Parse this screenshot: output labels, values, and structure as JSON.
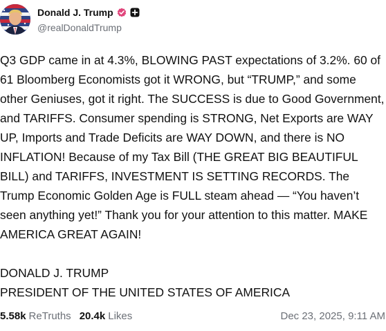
{
  "author": {
    "display_name": "Donald J. Trump",
    "handle": "@realDonaldTrump",
    "verified_badge_color": "#e0457b",
    "avatar_icon": "profile-avatar"
  },
  "post": {
    "text": "Q3 GDP came in at 4.3%, BLOWING PAST expectations of 3.2%. 60 of 61 Bloomberg Economists got it WRONG, but “TRUMP,” and some other Geniuses, got it right. The SUCCESS is due to Good Government, and TARIFFS. Consumer spending is STRONG, Net Exports are WAY UP, Imports and Trade Deficits are WAY DOWN, and there is NO INFLATION! Because of my Tax Bill (THE GREAT BIG BEAUTIFUL BILL) and TARIFFS, INVESTMENT IS SETTING RECORDS. The Trump Economic Golden Age is FULL steam ahead — “You haven’t seen anything yet!” Thank you for your attention to this matter. MAKE AMERICA GREAT AGAIN!\n\nDONALD J. TRUMP\nPRESIDENT OF THE UNITED STATES OF AMERICA"
  },
  "stats": {
    "retruths_count": "5.58k",
    "retruths_label": "ReTruths",
    "likes_count": "20.4k",
    "likes_label": "Likes",
    "timestamp": "Dec 23, 2025, 9:11 AM"
  }
}
